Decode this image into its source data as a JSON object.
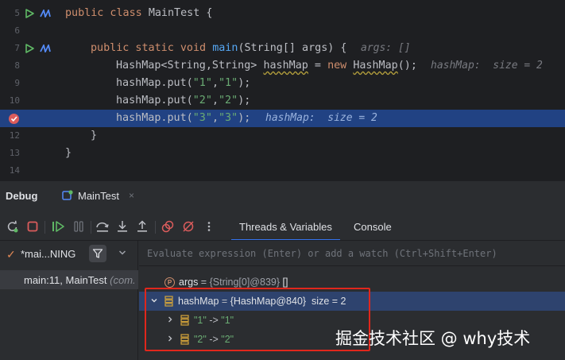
{
  "editor": {
    "lines": [
      {
        "num": "5",
        "code": "public class MainTest {"
      },
      {
        "num": "6",
        "code": ""
      },
      {
        "num": "7",
        "code": "    public static void main(String[] args) {",
        "hint": "args: []"
      },
      {
        "num": "8",
        "code": "        HashMap<String,String> hashMap = new HashMap();",
        "hint": "hashMap:  size = 2"
      },
      {
        "num": "9",
        "code": "        hashMap.put(\"1\",\"1\");"
      },
      {
        "num": "10",
        "code": "        hashMap.put(\"2\",\"2\");"
      },
      {
        "num": "11",
        "code": "        hashMap.put(\"3\",\"3\");",
        "hint": "hashMap:  size = 2"
      },
      {
        "num": "12",
        "code": "    }"
      },
      {
        "num": "13",
        "code": "}"
      },
      {
        "num": "14",
        "code": ""
      }
    ]
  },
  "debug": {
    "title": "Debug",
    "tab_label": "MainTest",
    "tab_close": "×",
    "sub_tabs": [
      "Threads & Variables",
      "Console"
    ],
    "thread": {
      "check": "✓",
      "name": "*mai...NING"
    },
    "frame": {
      "main": "main:11, MainTest",
      "pkg": "(com."
    },
    "eval_placeholder": "Evaluate expression (Enter) or add a watch (Ctrl+Shift+Enter)",
    "variables": [
      {
        "name": "args",
        "value": "{String[0]@839}",
        "extra": "[]"
      },
      {
        "name": "hashMap",
        "value": "{HashMap@840}",
        "extra": "size = 2"
      },
      {
        "key": "\"1\"",
        "arrow": "->",
        "val": "\"1\""
      },
      {
        "key": "\"2\"",
        "arrow": "->",
        "val": "\"2\""
      }
    ]
  },
  "watermark": "掘金技术社区 @ why技术",
  "colors": {
    "breakpoint": "#db5c5c",
    "highlight": "#214283",
    "accent": "#3574f0",
    "red_box": "#e0271c"
  }
}
